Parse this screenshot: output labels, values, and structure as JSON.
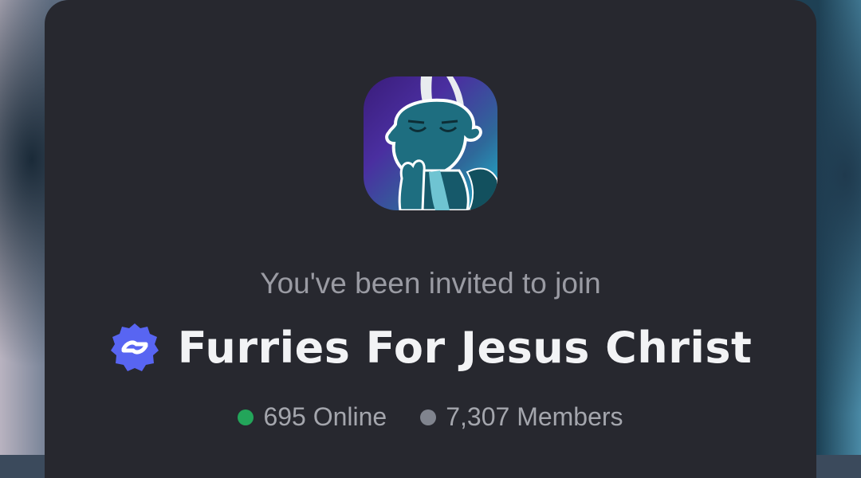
{
  "invite": {
    "heading": "You've been invited to join",
    "server_name": "Furries For Jesus Christ",
    "verified_icon": "verified-badge-icon",
    "server_icon": "server-avatar-dragon-praying",
    "online": "695 Online",
    "members": "7,307 Members"
  },
  "colors": {
    "modal_bg": "#27282f",
    "online_dot": "#23a55a",
    "members_dot": "#80848e",
    "verified_badge": "#5865f2"
  }
}
